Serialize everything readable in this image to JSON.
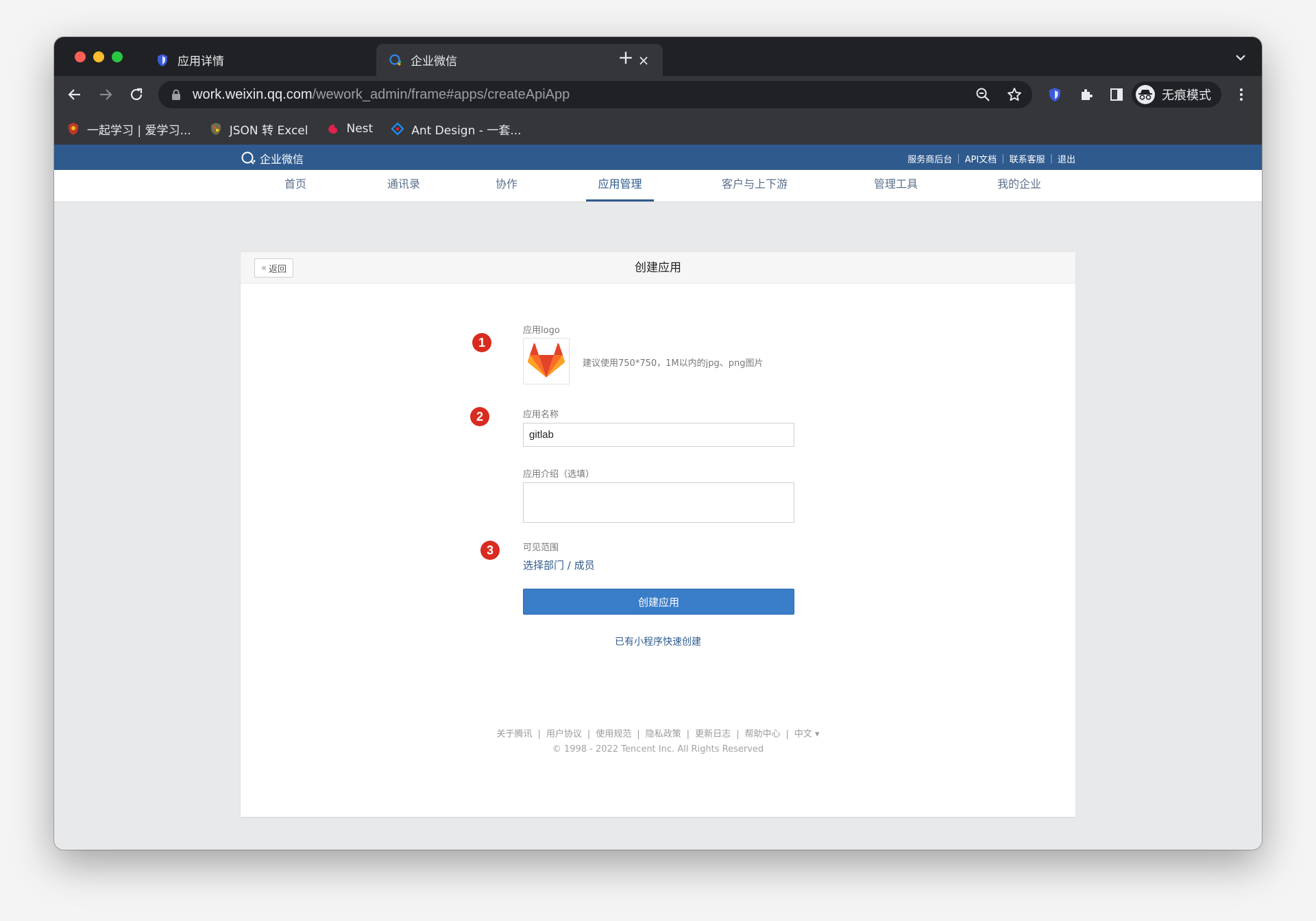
{
  "browser": {
    "tabs": [
      {
        "title": "应用详情",
        "icon": "shield-icon",
        "active": false
      },
      {
        "title": "企业微信",
        "icon": "wecom-icon",
        "active": true
      }
    ],
    "url_host": "work.weixin.qq.com",
    "url_path": "/wework_admin/frame#apps/createApiApp",
    "profile_label": "无痕模式",
    "bookmarks": [
      {
        "label": "一起学习 | 爱学习...",
        "icon": "red-shield-icon"
      },
      {
        "label": "JSON 转 Excel",
        "icon": "json-excel-icon"
      },
      {
        "label": "Nest",
        "icon": "nest-icon"
      },
      {
        "label": "Ant Design - 一套...",
        "icon": "ant-design-icon"
      }
    ]
  },
  "wecom": {
    "brand": "企业微信",
    "top_links": [
      "服务商后台",
      "API文档",
      "联系客服",
      "退出"
    ],
    "nav": [
      "首页",
      "通讯录",
      "协作",
      "应用管理",
      "客户与上下游",
      "管理工具",
      "我的企业"
    ],
    "nav_active": "应用管理"
  },
  "card": {
    "back_label": "返回",
    "title": "创建应用"
  },
  "form": {
    "logo_label": "应用logo",
    "logo_hint": "建议使用750*750，1M以内的jpg、png图片",
    "name_label": "应用名称",
    "name_value": "gitlab",
    "desc_label": "应用介绍（选填）",
    "desc_value": "",
    "scope_label": "可见范围",
    "scope_link": "选择部门 / 成员",
    "submit_label": "创建应用",
    "mini_program_link": "已有小程序快速创建"
  },
  "markers": [
    "1",
    "2",
    "3"
  ],
  "footer": {
    "links": [
      "关于腾讯",
      "用户协议",
      "使用规范",
      "隐私政策",
      "更新日志",
      "帮助中心",
      "中文 ▾"
    ],
    "copyright": "© 1998 - 2022 Tencent Inc. All Rights Reserved"
  },
  "colors": {
    "wecom_blue": "#2f5a8d",
    "button_blue": "#3a7dc9",
    "marker_red": "#d92b20"
  }
}
